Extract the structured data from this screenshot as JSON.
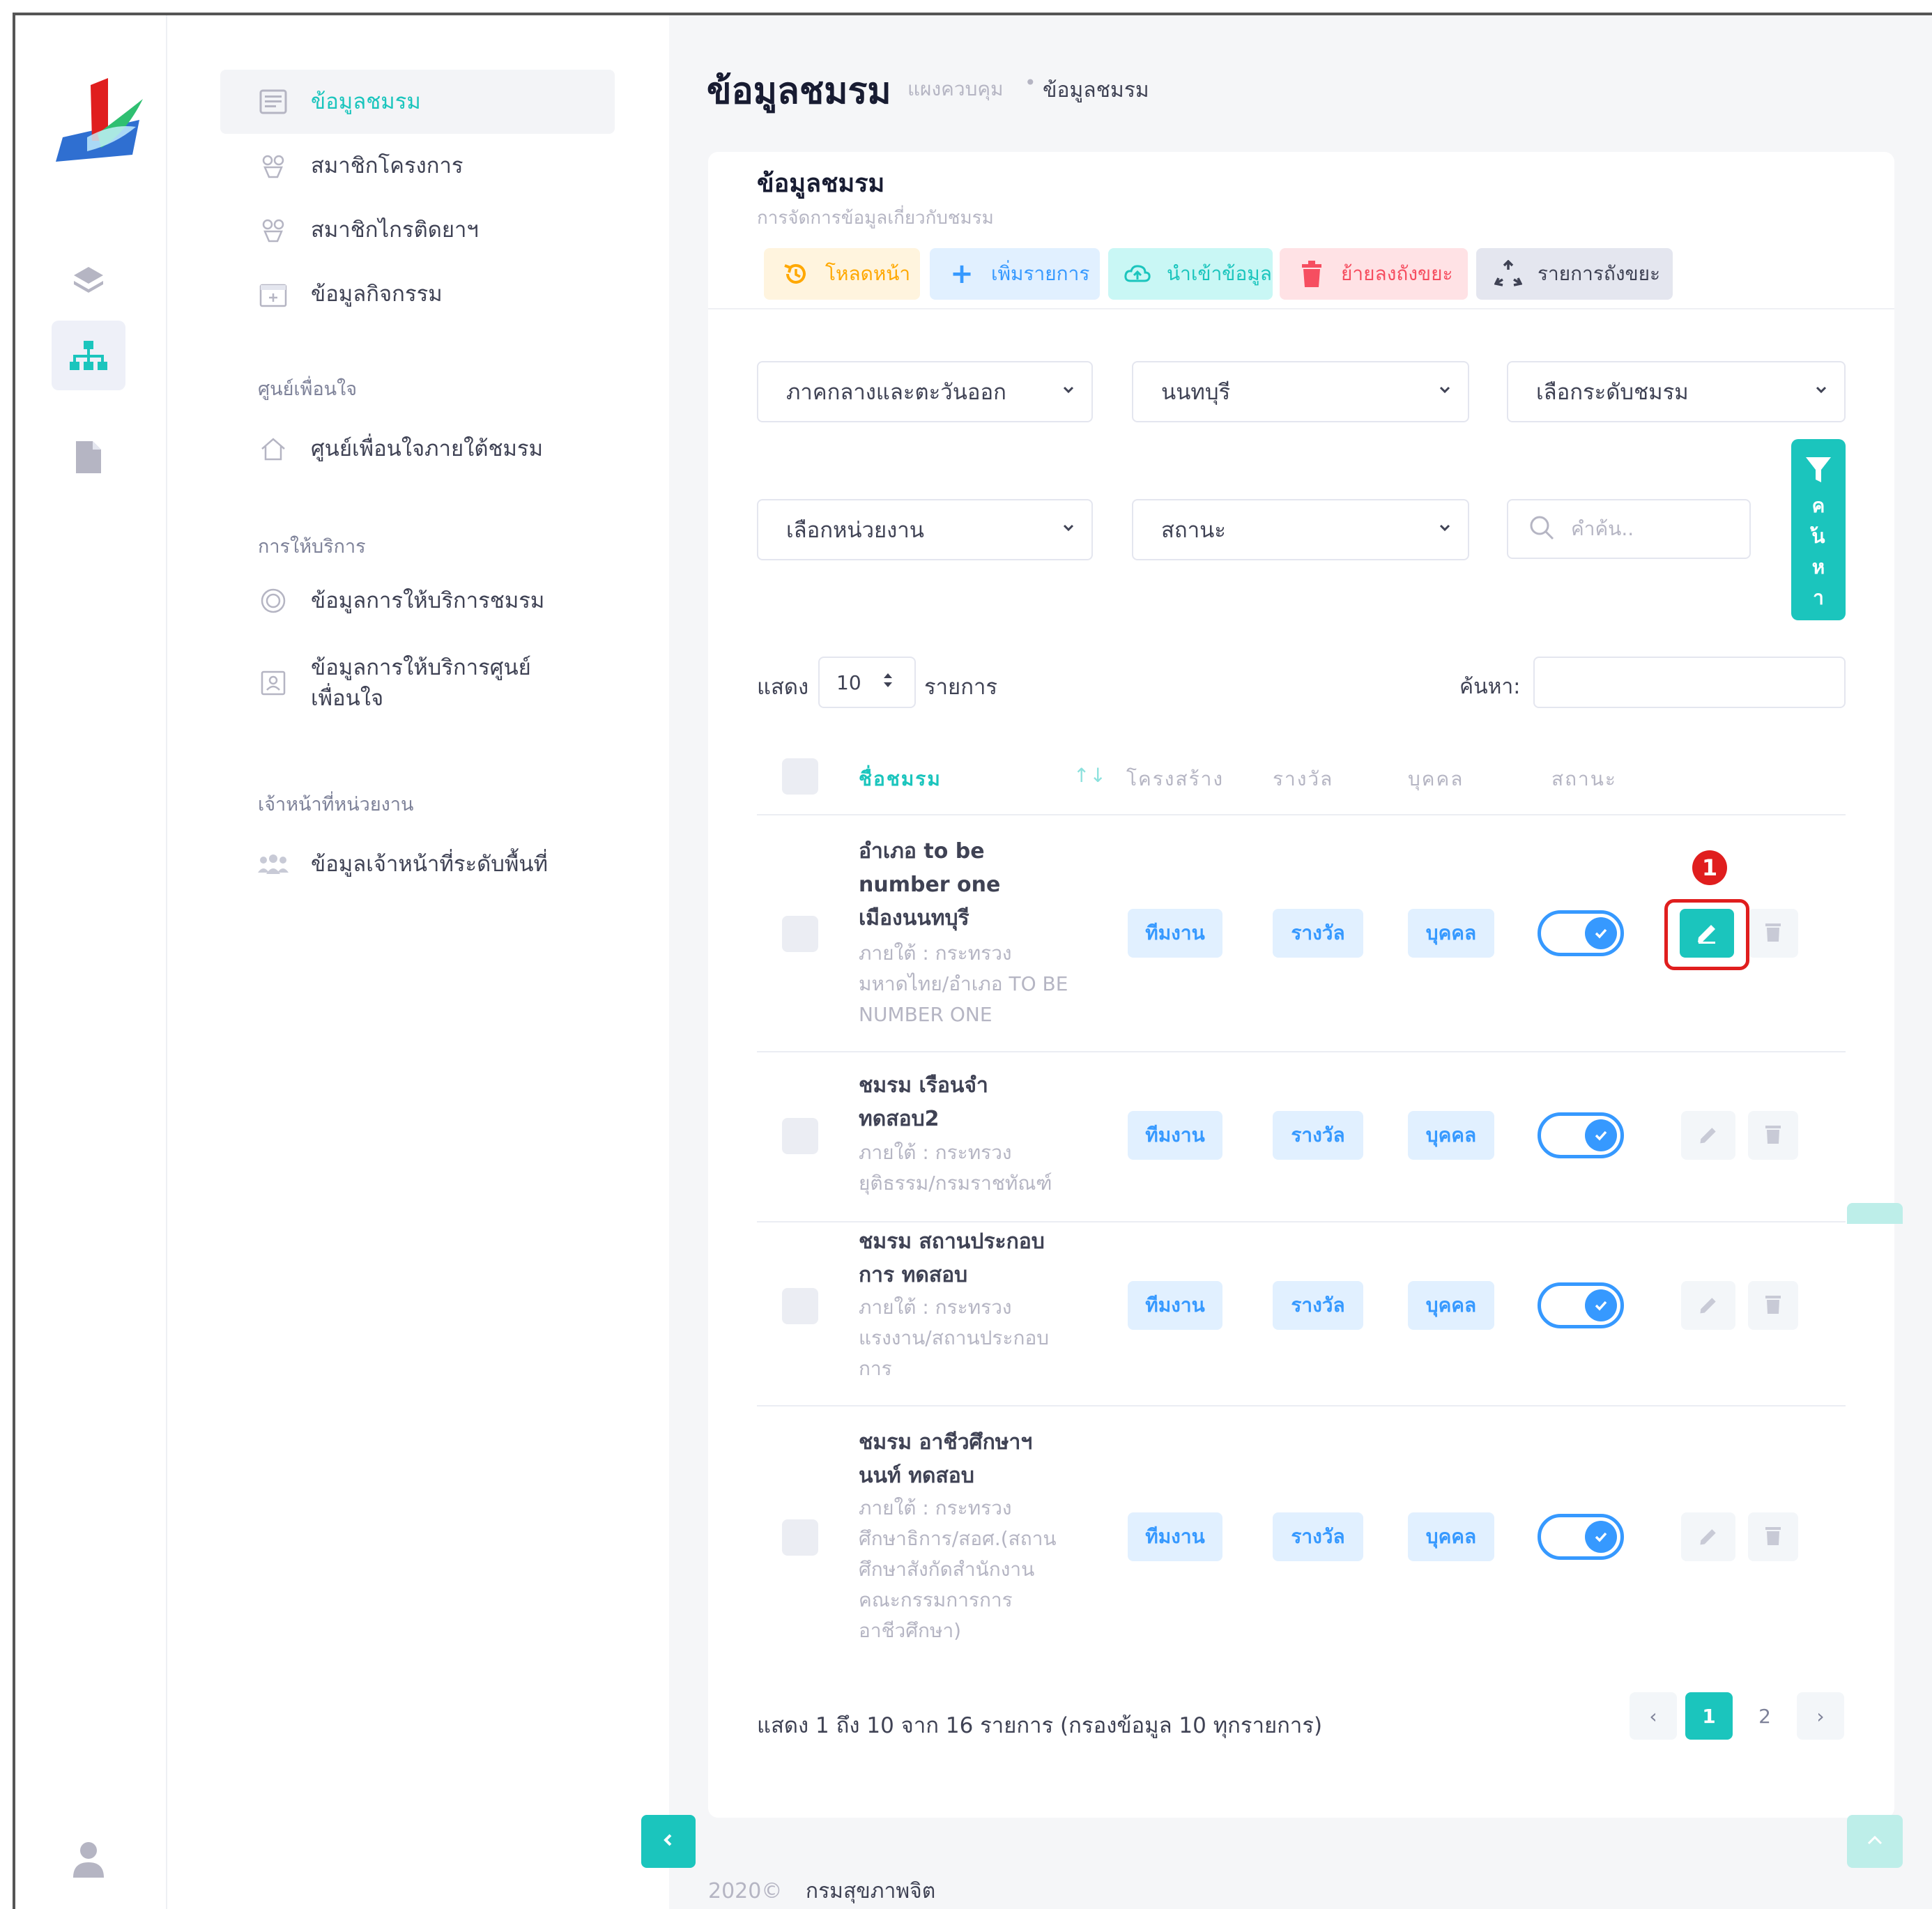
{
  "sidebar_menu": {
    "items": [
      {
        "label": "ข้อมูลชมรม",
        "icon": "list-icon",
        "active": true
      },
      {
        "label": "สมาชิกโครงการ",
        "icon": "users-icon"
      },
      {
        "label": "สมาชิกไกรติดยาฯ",
        "icon": "users-icon"
      },
      {
        "label": "ข้อมูลกิจกรรม",
        "icon": "calendar-icon"
      }
    ],
    "section_center": "ศูนย์เพื่อนใจ",
    "center_item": {
      "label": "ศูนย์เพื่อนใจภายใต้ชมรม",
      "icon": "home-icon"
    },
    "section_service": "การให้บริการ",
    "service_items": [
      {
        "label": "ข้อมูลการให้บริการชมรม",
        "icon": "target-icon"
      },
      {
        "label_line1": "ข้อมูลการให้บริการศูนย์",
        "label_line2": "เพื่อนใจ",
        "icon": "contact-card-icon"
      }
    ],
    "section_staff": "เจ้าหน้าที่หน่วยงาน",
    "staff_item": {
      "label": "ข้อมูลเจ้าหน้าที่ระดับพื้นที่",
      "icon": "group-icon"
    }
  },
  "header": {
    "title": "ข้อมูลชมรม",
    "breadcrumb_home": "แผงควบคุม",
    "breadcrumb_sep": "•",
    "breadcrumb_current": "ข้อมูลชมรม"
  },
  "card": {
    "title": "ข้อมูลชมรม",
    "subtitle": "การจัดการข้อมูลเกี่ยวกับชมรม"
  },
  "toolbar": {
    "reload": "โหลดหน้า",
    "add": "เพิ่มรายการ",
    "import": "นำเข้าข้อมูล",
    "trash": "ย้ายลงถังขยะ",
    "trash_list": "รายการถังขยะ"
  },
  "filters": {
    "region": "ภาคกลางและตะวันออก",
    "province": "นนทบุรี",
    "level": "เลือกระดับชมรม",
    "agency": "เลือกหน่วยงาน",
    "status": "สถานะ",
    "search_placeholder": "คำค้น..",
    "filter_button": "ค้นหา"
  },
  "table_controls": {
    "show": "แสดง",
    "page_length": "10",
    "records": "รายการ",
    "search_label": "ค้นหา:"
  },
  "table": {
    "columns": [
      "ชื่อชมรม",
      "โครงสร้าง",
      "รางวัล",
      "บุคคล",
      "สถานะ"
    ],
    "sort_icon": "↑↓",
    "rows": [
      {
        "name_lines": [
          "อำเภอ to be",
          "number one",
          "เมืองนนทบุรี"
        ],
        "under_lines": [
          "ภายใต้ : กระทรวง",
          "มหาดไทย/อำเภอ TO BE",
          "NUMBER ONE"
        ],
        "team": "ทีมงาน",
        "award": "รางวัล",
        "person": "บุคคล",
        "enabled": true
      },
      {
        "name_lines": [
          "ชมรม เรือนจำ",
          "ทดสอบ2"
        ],
        "under_lines": [
          "ภายใต้ : กระทรวง",
          "ยุติธรรม/กรมราชทัณฑ์"
        ],
        "team": "ทีมงาน",
        "award": "รางวัล",
        "person": "บุคคล",
        "enabled": true
      },
      {
        "name_lines": [
          "ชมรม สถานประกอบ",
          "การ ทดสอบ"
        ],
        "under_lines": [
          "ภายใต้ : กระทรวง",
          "แรงงาน/สถานประกอบ",
          "การ"
        ],
        "team": "ทีมงาน",
        "award": "รางวัล",
        "person": "บุคคล",
        "enabled": true
      },
      {
        "name_lines": [
          "ชมรม อาชีวศึกษาฯ",
          "นนท์ ทดสอบ"
        ],
        "under_lines": [
          "ภายใต้ : กระทรวง",
          "ศึกษาธิการ/สอศ.(สถาน",
          "ศึกษาสังกัดสำนักงาน",
          "คณะกรรมการการ",
          "อาชีวศึกษา)"
        ],
        "team": "ทีมงาน",
        "award": "รางวัล",
        "person": "บุคคล",
        "enabled": true
      }
    ]
  },
  "annotation": {
    "marker": "1"
  },
  "pagination": {
    "info": "แสดง 1 ถึง 10 จาก 16 รายการ (กรองข้อมูล 10 ทุกรายการ)",
    "prev": "‹",
    "pages": [
      "1",
      "2"
    ],
    "next": "›"
  },
  "footer": {
    "year": "2020©",
    "org": "กรมสุขภาพจิต"
  },
  "colors": {
    "accent": "#1bc5bd",
    "primary": "#3699ff",
    "danger": "#f64e60",
    "annotation": "#e01e1e"
  }
}
